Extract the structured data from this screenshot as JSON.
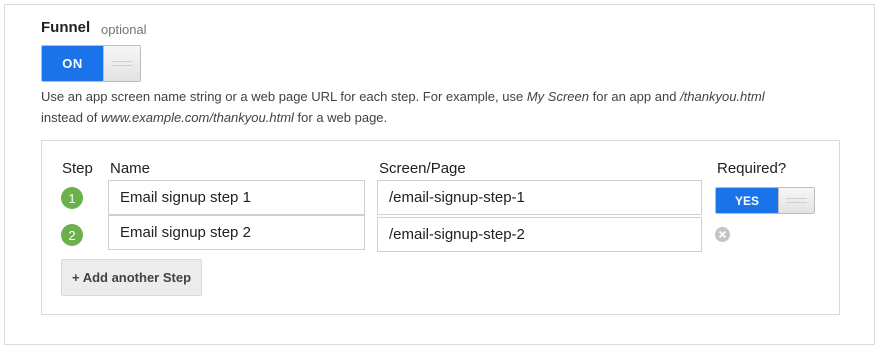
{
  "funnel": {
    "title": "Funnel",
    "optional_label": "optional",
    "toggle_label": "ON",
    "toggle_state": "on",
    "description_parts": {
      "p1": "Use an app screen name string or a web page URL for each step. For example, use ",
      "e1": "My Screen",
      "p2": " for an app and ",
      "e2": "/thankyou.html",
      "p3": " instead of ",
      "e3": "www.example.com/thankyou.html",
      "p4": " for a web page."
    }
  },
  "steps_table": {
    "headers": {
      "step": "Step",
      "name": "Name",
      "page": "Screen/Page",
      "required": "Required?"
    },
    "rows": [
      {
        "number": "1",
        "name": "Email signup step 1",
        "page": "/email-signup-step-1",
        "required_label": "YES",
        "required": true
      },
      {
        "number": "2",
        "name": "Email signup step 2",
        "page": "/email-signup-step-2",
        "remove_icon": "close-circle-icon"
      }
    ],
    "add_button_label": "+ Add another Step"
  },
  "colors": {
    "accent": "#1a73e8",
    "step_badge": "#6ab04c",
    "remove_icon": "#c4c4c4"
  }
}
